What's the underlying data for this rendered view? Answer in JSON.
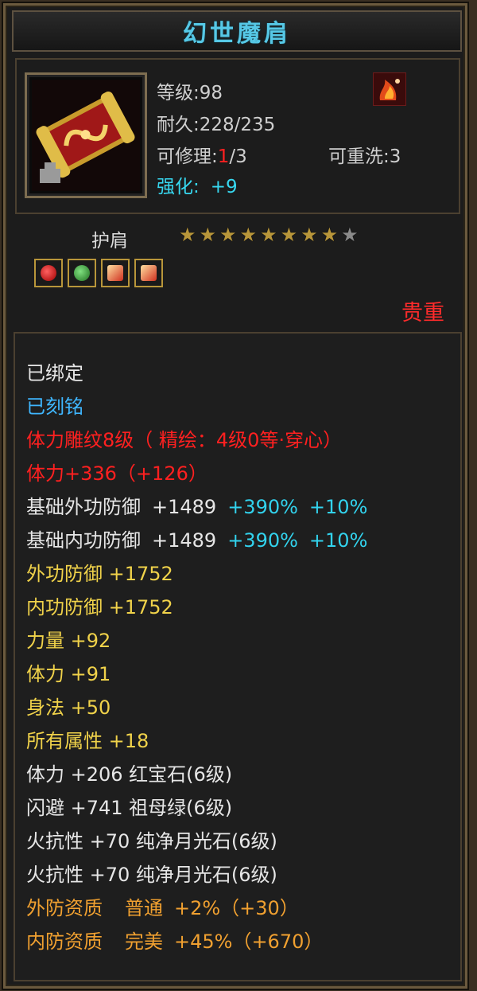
{
  "title": "幻世魔肩",
  "item": {
    "icon": "pauldron-icon",
    "level_label": "等级:",
    "level": "98",
    "durability_label": "耐久:",
    "durability": "228/235",
    "repair_label": "可修理:",
    "repair_used": "1",
    "repair_total": "/3",
    "rewash": "可重洗:3",
    "enhance_label": "强化:",
    "enhance_value": "+9"
  },
  "slot": {
    "name": "护肩",
    "stars_filled": 8,
    "stars_total": 9,
    "gems": [
      "ruby-gem-icon",
      "emerald-gem-icon",
      "moonstone-gem-icon",
      "moonstone-gem-icon"
    ],
    "rarity": "贵重"
  },
  "attributes": {
    "bound": "已绑定",
    "engraved": "已刻铭",
    "carving": "体力雕纹8级（ 精绘：4级0等·穿心）",
    "stamina_bonus": "体力+336（+126）",
    "base_outer_def": {
      "label": "基础外功防御",
      "value": "+1489",
      "pct": "+390%",
      "extra": "+10%"
    },
    "base_inner_def": {
      "label": "基础内功防御",
      "value": "+1489",
      "pct": "+390%",
      "extra": "+10%"
    },
    "outer_def": "外功防御 +1752",
    "inner_def": "内功防御 +1752",
    "strength": "力量 +92",
    "stamina": "体力 +91",
    "agility": "身法 +50",
    "all_attr": "所有属性 +18",
    "gem1": "体力 +206 红宝石(6级)",
    "gem2": "闪避 +741 祖母绿(6级)",
    "gem3": "火抗性 +70 纯净月光石(6级)",
    "gem4": "火抗性 +70 纯净月光石(6级)",
    "outer_quality": {
      "label": "外防资质",
      "grade": "普通",
      "value": "+2%（+30）"
    },
    "inner_quality": {
      "label": "内防资质",
      "grade": "完美",
      "value": "+45%（+670）"
    }
  },
  "colors": {
    "title": "#56c8e6",
    "rarity": "#ff2b2b",
    "bound": "#e6e6e6",
    "engraved": "#3fb6ff",
    "carving": "#ff2020",
    "attribute": "#f0d24a",
    "quality": "#f0a030"
  }
}
